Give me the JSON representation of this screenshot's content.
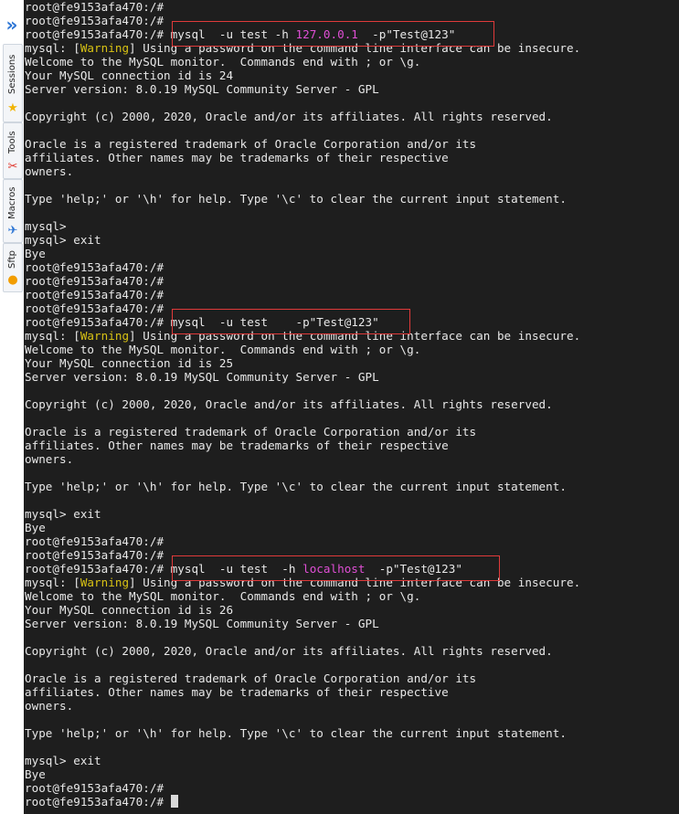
{
  "sidebar": {
    "collapse_glyph": "»",
    "tabs": [
      {
        "label": "Sessions",
        "icon": "star-icon",
        "glyph": "★",
        "color": "#f1b400"
      },
      {
        "label": "Tools",
        "icon": "tools-icon",
        "glyph": "✂",
        "color": "#e0352b"
      },
      {
        "label": "Macros",
        "icon": "macro-icon",
        "glyph": "✈",
        "color": "#2b74d4"
      },
      {
        "label": "Sftp",
        "icon": "sftp-icon",
        "glyph": "●",
        "color": "#f29d00"
      }
    ]
  },
  "terminal": {
    "colors": {
      "background": "#1e1e1e",
      "text": "#e8e8e8",
      "warning": "#d8c214",
      "host": "#e04fd6",
      "highlight_box": "#e03a3a"
    },
    "prompt": "root@fe9153afa470:/# ",
    "lines": [
      {
        "segments": [
          {
            "text": "root@fe9153afa470:/#"
          }
        ]
      },
      {
        "segments": [
          {
            "text": "root@fe9153afa470:/#"
          }
        ]
      },
      {
        "segments": [
          {
            "text": "root@fe9153afa470:/# mysql  -u test -h "
          },
          {
            "text": "127.0.0.1",
            "cls": "mag"
          },
          {
            "text": "  -p\"Test@123\""
          }
        ]
      },
      {
        "segments": [
          {
            "text": "mysql: ["
          },
          {
            "text": "Warning",
            "cls": "warn"
          },
          {
            "text": "] Using a password on the command line interface can be insecure."
          }
        ]
      },
      {
        "segments": [
          {
            "text": "Welcome to the MySQL monitor.  Commands end with ; or \\g."
          }
        ]
      },
      {
        "segments": [
          {
            "text": "Your MySQL connection id is 24"
          }
        ]
      },
      {
        "segments": [
          {
            "text": "Server version: 8.0.19 MySQL Community Server - GPL"
          }
        ]
      },
      {
        "segments": [
          {
            "text": ""
          }
        ]
      },
      {
        "segments": [
          {
            "text": "Copyright (c) 2000, 2020, Oracle and/or its affiliates. All rights reserved."
          }
        ]
      },
      {
        "segments": [
          {
            "text": ""
          }
        ]
      },
      {
        "segments": [
          {
            "text": "Oracle is a registered trademark of Oracle Corporation and/or its"
          }
        ]
      },
      {
        "segments": [
          {
            "text": "affiliates. Other names may be trademarks of their respective"
          }
        ]
      },
      {
        "segments": [
          {
            "text": "owners."
          }
        ]
      },
      {
        "segments": [
          {
            "text": ""
          }
        ]
      },
      {
        "segments": [
          {
            "text": "Type 'help;' or '\\h' for help. Type '\\c' to clear the current input statement."
          }
        ]
      },
      {
        "segments": [
          {
            "text": ""
          }
        ]
      },
      {
        "segments": [
          {
            "text": "mysql>"
          }
        ]
      },
      {
        "segments": [
          {
            "text": "mysql> exit"
          }
        ]
      },
      {
        "segments": [
          {
            "text": "Bye"
          }
        ]
      },
      {
        "segments": [
          {
            "text": "root@fe9153afa470:/#"
          }
        ]
      },
      {
        "segments": [
          {
            "text": "root@fe9153afa470:/#"
          }
        ]
      },
      {
        "segments": [
          {
            "text": "root@fe9153afa470:/#"
          }
        ]
      },
      {
        "segments": [
          {
            "text": "root@fe9153afa470:/#"
          }
        ]
      },
      {
        "segments": [
          {
            "text": "root@fe9153afa470:/# mysql  -u test    -p\"Test@123\""
          }
        ]
      },
      {
        "segments": [
          {
            "text": "mysql: ["
          },
          {
            "text": "Warning",
            "cls": "warn"
          },
          {
            "text": "] Using a password on the command line interface can be insecure."
          }
        ]
      },
      {
        "segments": [
          {
            "text": "Welcome to the MySQL monitor.  Commands end with ; or \\g."
          }
        ]
      },
      {
        "segments": [
          {
            "text": "Your MySQL connection id is 25"
          }
        ]
      },
      {
        "segments": [
          {
            "text": "Server version: 8.0.19 MySQL Community Server - GPL"
          }
        ]
      },
      {
        "segments": [
          {
            "text": ""
          }
        ]
      },
      {
        "segments": [
          {
            "text": "Copyright (c) 2000, 2020, Oracle and/or its affiliates. All rights reserved."
          }
        ]
      },
      {
        "segments": [
          {
            "text": ""
          }
        ]
      },
      {
        "segments": [
          {
            "text": "Oracle is a registered trademark of Oracle Corporation and/or its"
          }
        ]
      },
      {
        "segments": [
          {
            "text": "affiliates. Other names may be trademarks of their respective"
          }
        ]
      },
      {
        "segments": [
          {
            "text": "owners."
          }
        ]
      },
      {
        "segments": [
          {
            "text": ""
          }
        ]
      },
      {
        "segments": [
          {
            "text": "Type 'help;' or '\\h' for help. Type '\\c' to clear the current input statement."
          }
        ]
      },
      {
        "segments": [
          {
            "text": ""
          }
        ]
      },
      {
        "segments": [
          {
            "text": "mysql> exit"
          }
        ]
      },
      {
        "segments": [
          {
            "text": "Bye"
          }
        ]
      },
      {
        "segments": [
          {
            "text": "root@fe9153afa470:/#"
          }
        ]
      },
      {
        "segments": [
          {
            "text": "root@fe9153afa470:/#"
          }
        ]
      },
      {
        "segments": [
          {
            "text": "root@fe9153afa470:/# mysql  -u test  -h "
          },
          {
            "text": "localhost",
            "cls": "mag"
          },
          {
            "text": "  -p\"Test@123\""
          }
        ]
      },
      {
        "segments": [
          {
            "text": "mysql: ["
          },
          {
            "text": "Warning",
            "cls": "warn"
          },
          {
            "text": "] Using a password on the command line interface can be insecure."
          }
        ]
      },
      {
        "segments": [
          {
            "text": "Welcome to the MySQL monitor.  Commands end with ; or \\g."
          }
        ]
      },
      {
        "segments": [
          {
            "text": "Your MySQL connection id is 26"
          }
        ]
      },
      {
        "segments": [
          {
            "text": "Server version: 8.0.19 MySQL Community Server - GPL"
          }
        ]
      },
      {
        "segments": [
          {
            "text": ""
          }
        ]
      },
      {
        "segments": [
          {
            "text": "Copyright (c) 2000, 2020, Oracle and/or its affiliates. All rights reserved."
          }
        ]
      },
      {
        "segments": [
          {
            "text": ""
          }
        ]
      },
      {
        "segments": [
          {
            "text": "Oracle is a registered trademark of Oracle Corporation and/or its"
          }
        ]
      },
      {
        "segments": [
          {
            "text": "affiliates. Other names may be trademarks of their respective"
          }
        ]
      },
      {
        "segments": [
          {
            "text": "owners."
          }
        ]
      },
      {
        "segments": [
          {
            "text": ""
          }
        ]
      },
      {
        "segments": [
          {
            "text": "Type 'help;' or '\\h' for help. Type '\\c' to clear the current input statement."
          }
        ]
      },
      {
        "segments": [
          {
            "text": ""
          }
        ]
      },
      {
        "segments": [
          {
            "text": "mysql> exit"
          }
        ]
      },
      {
        "segments": [
          {
            "text": "Bye"
          }
        ]
      },
      {
        "segments": [
          {
            "text": "root@fe9153afa470:/#"
          }
        ]
      },
      {
        "segments": [
          {
            "text": "root@fe9153afa470:/# "
          }
        ],
        "cursor": true
      }
    ],
    "highlighted_commands": [
      2,
      23,
      41
    ]
  }
}
